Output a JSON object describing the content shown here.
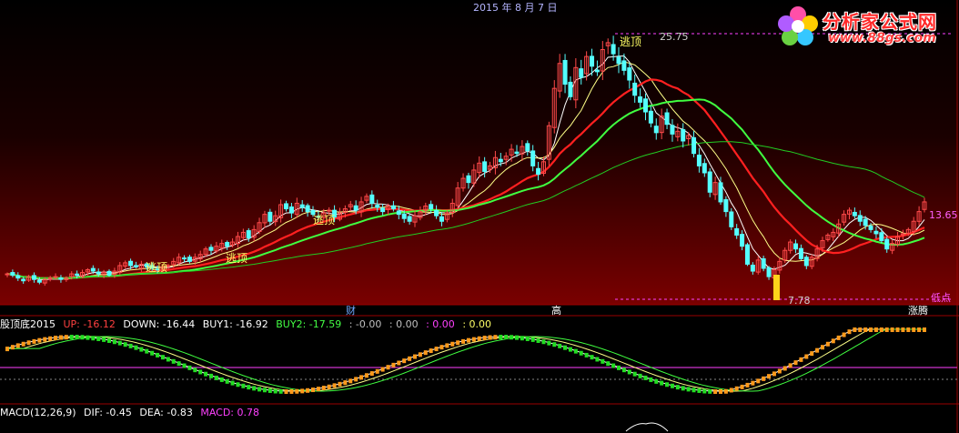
{
  "header": {
    "date": "2015 年 8 月 7 日"
  },
  "logo": {
    "title": "分析家公式网",
    "url": "www.88gs.com"
  },
  "price_labels": {
    "high": "25.75",
    "low": "7.78",
    "last": "13.65",
    "low_point": "低点"
  },
  "signals": {
    "escape_top": "逃顶"
  },
  "markers": {
    "cai": "财",
    "gao": "高",
    "bull": "涨腾"
  },
  "indicator_legend": {
    "name": "股顶底2015",
    "up": "UP: -16.12",
    "down": "DOWN: -16.44",
    "buy1": "BUY1: -16.92",
    "buy2": "BUY2: -17.59",
    "v1": ": -0.00",
    "v2": ": 0.00",
    "v3": ": 0.00",
    "v4": ": 0.00"
  },
  "macd_legend": {
    "name": "MACD(12,26,9)",
    "dif": "DIF: -0.45",
    "dea": "DEA: -0.83",
    "macd": "MACD: 0.78"
  },
  "colors": {
    "up_candle": "#ff4a4a",
    "down_candle": "#54ffff",
    "ma5": "#ffffff",
    "ma10": "#ffff88",
    "ma20": "#ff2020",
    "ma30": "#40ff40",
    "ma60": "#22cc22",
    "dash": "#ff40ff",
    "bar_up": "#ff9a1a",
    "bar_down": "#22dd22"
  },
  "chart_data": {
    "type": "candlestick",
    "ylim": [
      6.5,
      27
    ],
    "price_levels": {
      "high": 25.75,
      "low": 7.78
    },
    "closes": [
      8.4,
      8.3,
      8.1,
      7.9,
      8.2,
      8.0,
      7.8,
      8.0,
      8.1,
      8.2,
      8.0,
      8.1,
      8.4,
      8.3,
      8.5,
      8.7,
      8.6,
      8.4,
      8.5,
      8.3,
      8.6,
      9.0,
      9.2,
      9.0,
      8.9,
      9.1,
      8.9,
      8.8,
      8.7,
      8.9,
      9.0,
      9.3,
      9.6,
      9.5,
      9.3,
      9.6,
      9.8,
      10.2,
      10.1,
      10.4,
      10.6,
      10.4,
      10.7,
      11.1,
      11.4,
      11.0,
      11.6,
      12.1,
      12.7,
      12.2,
      12.6,
      13.4,
      13.1,
      12.8,
      13.5,
      13.2,
      12.9,
      12.7,
      12.5,
      12.8,
      13.0,
      12.5,
      12.8,
      13.1,
      13.4,
      13.0,
      13.6,
      14.0,
      13.5,
      13.2,
      12.9,
      13.3,
      13.1,
      12.7,
      12.4,
      12.2,
      12.6,
      12.9,
      13.3,
      13.1,
      12.6,
      12.2,
      12.8,
      13.5,
      14.6,
      15.3,
      15.0,
      15.9,
      16.4,
      15.8,
      16.2,
      16.8,
      16.5,
      16.9,
      17.4,
      17.1,
      17.6,
      17.3,
      16.2,
      15.6,
      16.5,
      19.1,
      21.8,
      23.6,
      22.1,
      21.2,
      23.3,
      22.6,
      24.1,
      23.4,
      23.0,
      24.6,
      25.1,
      24.3,
      23.6,
      23.1,
      22.4,
      21.3,
      20.8,
      20.1,
      19.3,
      18.6,
      19.8,
      19.2,
      18.5,
      18.7,
      18.0,
      18.4,
      17.1,
      16.2,
      15.7,
      14.3,
      15.0,
      13.6,
      12.9,
      11.8,
      11.2,
      10.4,
      9.1,
      8.6,
      9.4,
      8.8,
      8.2,
      8.7,
      9.3,
      10.1,
      10.7,
      10.2,
      9.5,
      9.0,
      9.6,
      10.2,
      10.8,
      11.2,
      11.4,
      12.0,
      12.7,
      13.0,
      12.6,
      12.2,
      11.9,
      11.6,
      11.3,
      10.8,
      10.2,
      10.6,
      11.1,
      11.3,
      11.6,
      12.2,
      12.9,
      13.6
    ],
    "series": [
      {
        "name": "MA5"
      },
      {
        "name": "MA10"
      },
      {
        "name": "MA20"
      },
      {
        "name": "MA30"
      },
      {
        "name": "MA60"
      }
    ],
    "signal_labels": [
      "逃顶",
      "逃顶",
      "逃顶",
      "逃顶"
    ]
  }
}
